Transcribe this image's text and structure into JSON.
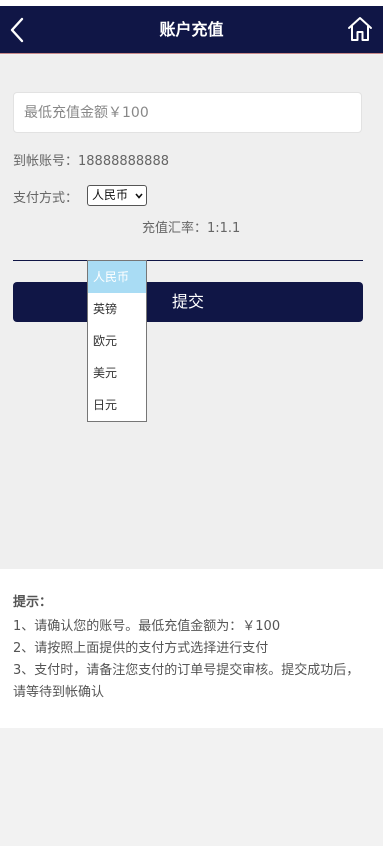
{
  "header": {
    "title": "账户充值",
    "background": "#101646"
  },
  "form": {
    "amount_placeholder": "最低充值金额￥100",
    "account_label": "到帐账号：",
    "account_value": "18888888888",
    "payment_label": "支付方式：",
    "payment_selected": "人民币",
    "payment_options": [
      "人民币",
      "英镑",
      "欧元",
      "美元",
      "日元"
    ],
    "rate_text": "充值汇率：1:1.1",
    "submit_label": "提交"
  },
  "tips": {
    "title": "提示：",
    "items": [
      "1、请确认您的账号。最低充值金额为：￥100",
      "2、请按照上面提供的支付方式选择进行支付",
      "3、支付时，请备注您支付的订单号提交审核。提交成功后，请等待到帐确认"
    ]
  },
  "icons": {
    "back": "chevron-left-icon",
    "home": "home-icon"
  }
}
